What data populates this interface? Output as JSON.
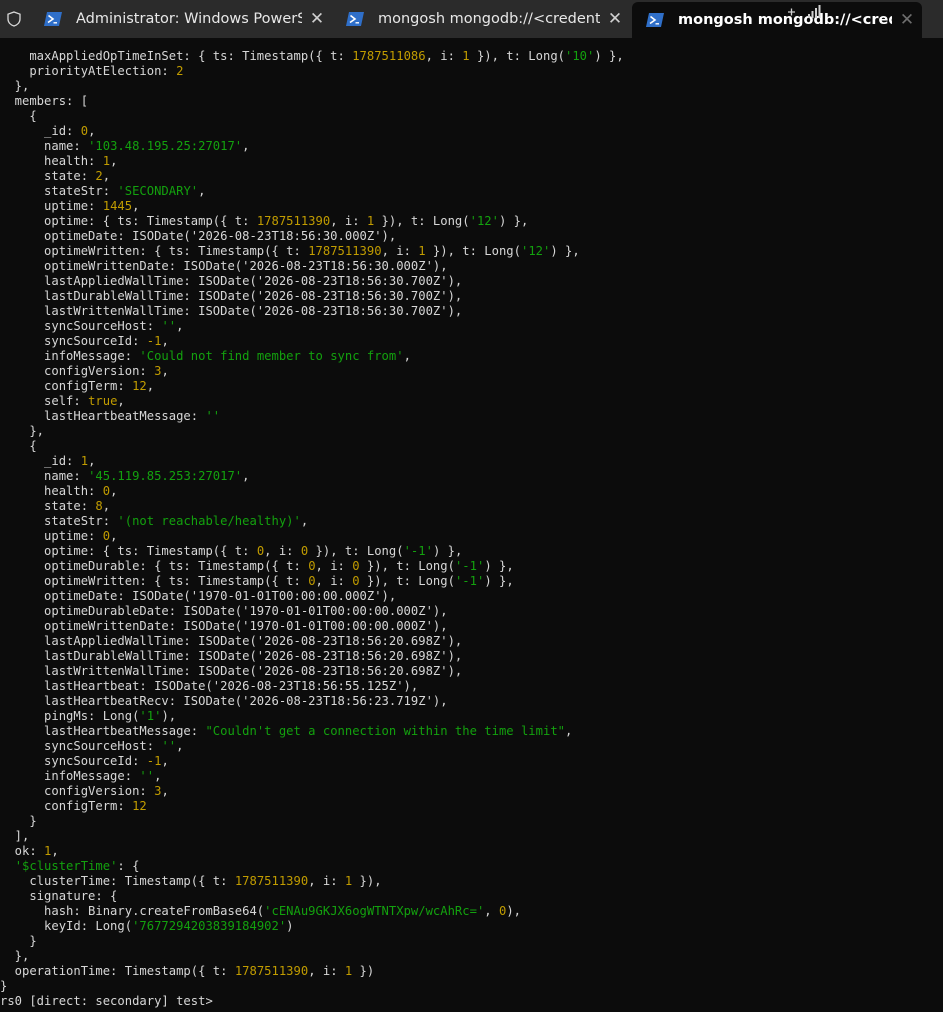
{
  "tabs": [
    {
      "title": "Administrator: Windows PowerShell",
      "close": "✕"
    },
    {
      "title": "mongosh mongodb://<credentials>@",
      "close": "✕"
    },
    {
      "title": "mongosh mongodb://<credentials>@",
      "close": "✕",
      "active": true
    }
  ],
  "icons": {
    "shield": "shield-icon",
    "powershell": "powershell-icon",
    "signal": "signal-icon"
  },
  "colors": {
    "background": "#0c0c0c",
    "text": "#d7d7d7",
    "string": "#13a10e",
    "number": "#c19c00",
    "tabbar": "#2b2b2b"
  },
  "terminal": {
    "lines": [
      [
        [
          "    maxAppliedOpTimeInSet: { ts: Timestamp({ t: ",
          "p"
        ],
        [
          "1787511086",
          "n"
        ],
        [
          ", i: ",
          "p"
        ],
        [
          "1",
          "n"
        ],
        [
          " }), t: Long(",
          "p"
        ],
        [
          "'10'",
          "s"
        ],
        [
          ") },",
          "p"
        ]
      ],
      [
        [
          "    priorityAtElection: ",
          "p"
        ],
        [
          "2",
          "n"
        ]
      ],
      [
        [
          "  },",
          "p"
        ]
      ],
      [
        [
          "  members: [",
          "p"
        ]
      ],
      [
        [
          "    {",
          "p"
        ]
      ],
      [
        [
          "      _id: ",
          "p"
        ],
        [
          "0",
          "n"
        ],
        [
          ",",
          "p"
        ]
      ],
      [
        [
          "      name: ",
          "p"
        ],
        [
          "'103.48.195.25:27017'",
          "s"
        ],
        [
          ",",
          "p"
        ]
      ],
      [
        [
          "      health: ",
          "p"
        ],
        [
          "1",
          "n"
        ],
        [
          ",",
          "p"
        ]
      ],
      [
        [
          "      state: ",
          "p"
        ],
        [
          "2",
          "n"
        ],
        [
          ",",
          "p"
        ]
      ],
      [
        [
          "      stateStr: ",
          "p"
        ],
        [
          "'SECONDARY'",
          "s"
        ],
        [
          ",",
          "p"
        ]
      ],
      [
        [
          "      uptime: ",
          "p"
        ],
        [
          "1445",
          "n"
        ],
        [
          ",",
          "p"
        ]
      ],
      [
        [
          "      optime: { ts: Timestamp({ t: ",
          "p"
        ],
        [
          "1787511390",
          "n"
        ],
        [
          ", i: ",
          "p"
        ],
        [
          "1",
          "n"
        ],
        [
          " }), t: Long(",
          "p"
        ],
        [
          "'12'",
          "s"
        ],
        [
          ") },",
          "p"
        ]
      ],
      [
        [
          "      optimeDate: ISODate('2026-08-23T18:56:30.000Z'),",
          "p"
        ]
      ],
      [
        [
          "      optimeWritten: { ts: Timestamp({ t: ",
          "p"
        ],
        [
          "1787511390",
          "n"
        ],
        [
          ", i: ",
          "p"
        ],
        [
          "1",
          "n"
        ],
        [
          " }), t: Long(",
          "p"
        ],
        [
          "'12'",
          "s"
        ],
        [
          ") },",
          "p"
        ]
      ],
      [
        [
          "      optimeWrittenDate: ISODate('2026-08-23T18:56:30.000Z'),",
          "p"
        ]
      ],
      [
        [
          "      lastAppliedWallTime: ISODate('2026-08-23T18:56:30.700Z'),",
          "p"
        ]
      ],
      [
        [
          "      lastDurableWallTime: ISODate('2026-08-23T18:56:30.700Z'),",
          "p"
        ]
      ],
      [
        [
          "      lastWrittenWallTime: ISODate('2026-08-23T18:56:30.700Z'),",
          "p"
        ]
      ],
      [
        [
          "      syncSourceHost: ",
          "p"
        ],
        [
          "''",
          "s"
        ],
        [
          ",",
          "p"
        ]
      ],
      [
        [
          "      syncSourceId: ",
          "p"
        ],
        [
          "-1",
          "n"
        ],
        [
          ",",
          "p"
        ]
      ],
      [
        [
          "      infoMessage: ",
          "p"
        ],
        [
          "'Could not find member to sync from'",
          "s"
        ],
        [
          ",",
          "p"
        ]
      ],
      [
        [
          "      configVersion: ",
          "p"
        ],
        [
          "3",
          "n"
        ],
        [
          ",",
          "p"
        ]
      ],
      [
        [
          "      configTerm: ",
          "p"
        ],
        [
          "12",
          "n"
        ],
        [
          ",",
          "p"
        ]
      ],
      [
        [
          "      self: ",
          "p"
        ],
        [
          "true",
          "n"
        ],
        [
          ",",
          "p"
        ]
      ],
      [
        [
          "      lastHeartbeatMessage: ",
          "p"
        ],
        [
          "''",
          "s"
        ]
      ],
      [
        [
          "    },",
          "p"
        ]
      ],
      [
        [
          "    {",
          "p"
        ]
      ],
      [
        [
          "      _id: ",
          "p"
        ],
        [
          "1",
          "n"
        ],
        [
          ",",
          "p"
        ]
      ],
      [
        [
          "      name: ",
          "p"
        ],
        [
          "'45.119.85.253:27017'",
          "s"
        ],
        [
          ",",
          "p"
        ]
      ],
      [
        [
          "      health: ",
          "p"
        ],
        [
          "0",
          "n"
        ],
        [
          ",",
          "p"
        ]
      ],
      [
        [
          "      state: ",
          "p"
        ],
        [
          "8",
          "n"
        ],
        [
          ",",
          "p"
        ]
      ],
      [
        [
          "      stateStr: ",
          "p"
        ],
        [
          "'(not reachable/healthy)'",
          "s"
        ],
        [
          ",",
          "p"
        ]
      ],
      [
        [
          "      uptime: ",
          "p"
        ],
        [
          "0",
          "n"
        ],
        [
          ",",
          "p"
        ]
      ],
      [
        [
          "      optime: { ts: Timestamp({ t: ",
          "p"
        ],
        [
          "0",
          "n"
        ],
        [
          ", i: ",
          "p"
        ],
        [
          "0",
          "n"
        ],
        [
          " }), t: Long(",
          "p"
        ],
        [
          "'-1'",
          "s"
        ],
        [
          ") },",
          "p"
        ]
      ],
      [
        [
          "      optimeDurable: { ts: Timestamp({ t: ",
          "p"
        ],
        [
          "0",
          "n"
        ],
        [
          ", i: ",
          "p"
        ],
        [
          "0",
          "n"
        ],
        [
          " }), t: Long(",
          "p"
        ],
        [
          "'-1'",
          "s"
        ],
        [
          ") },",
          "p"
        ]
      ],
      [
        [
          "      optimeWritten: { ts: Timestamp({ t: ",
          "p"
        ],
        [
          "0",
          "n"
        ],
        [
          ", i: ",
          "p"
        ],
        [
          "0",
          "n"
        ],
        [
          " }), t: Long(",
          "p"
        ],
        [
          "'-1'",
          "s"
        ],
        [
          ") },",
          "p"
        ]
      ],
      [
        [
          "      optimeDate: ISODate('1970-01-01T00:00:00.000Z'),",
          "p"
        ]
      ],
      [
        [
          "      optimeDurableDate: ISODate('1970-01-01T00:00:00.000Z'),",
          "p"
        ]
      ],
      [
        [
          "      optimeWrittenDate: ISODate('1970-01-01T00:00:00.000Z'),",
          "p"
        ]
      ],
      [
        [
          "      lastAppliedWallTime: ISODate('2026-08-23T18:56:20.698Z'),",
          "p"
        ]
      ],
      [
        [
          "      lastDurableWallTime: ISODate('2026-08-23T18:56:20.698Z'),",
          "p"
        ]
      ],
      [
        [
          "      lastWrittenWallTime: ISODate('2026-08-23T18:56:20.698Z'),",
          "p"
        ]
      ],
      [
        [
          "      lastHeartbeat: ISODate('2026-08-23T18:56:55.125Z'),",
          "p"
        ]
      ],
      [
        [
          "      lastHeartbeatRecv: ISODate('2026-08-23T18:56:23.719Z'),",
          "p"
        ]
      ],
      [
        [
          "      pingMs: Long(",
          "p"
        ],
        [
          "'1'",
          "s"
        ],
        [
          "),",
          "p"
        ]
      ],
      [
        [
          "      lastHeartbeatMessage: ",
          "p"
        ],
        [
          "\"Couldn't get a connection within the time limit\"",
          "s"
        ],
        [
          ",",
          "p"
        ]
      ],
      [
        [
          "      syncSourceHost: ",
          "p"
        ],
        [
          "''",
          "s"
        ],
        [
          ",",
          "p"
        ]
      ],
      [
        [
          "      syncSourceId: ",
          "p"
        ],
        [
          "-1",
          "n"
        ],
        [
          ",",
          "p"
        ]
      ],
      [
        [
          "      infoMessage: ",
          "p"
        ],
        [
          "''",
          "s"
        ],
        [
          ",",
          "p"
        ]
      ],
      [
        [
          "      configVersion: ",
          "p"
        ],
        [
          "3",
          "n"
        ],
        [
          ",",
          "p"
        ]
      ],
      [
        [
          "      configTerm: ",
          "p"
        ],
        [
          "12",
          "n"
        ]
      ],
      [
        [
          "    }",
          "p"
        ]
      ],
      [
        [
          "  ],",
          "p"
        ]
      ],
      [
        [
          "  ok: ",
          "p"
        ],
        [
          "1",
          "n"
        ],
        [
          ",",
          "p"
        ]
      ],
      [
        [
          "  ",
          "p"
        ],
        [
          "'$clusterTime'",
          "s"
        ],
        [
          ": {",
          "p"
        ]
      ],
      [
        [
          "    clusterTime: Timestamp({ t: ",
          "p"
        ],
        [
          "1787511390",
          "n"
        ],
        [
          ", i: ",
          "p"
        ],
        [
          "1",
          "n"
        ],
        [
          " }),",
          "p"
        ]
      ],
      [
        [
          "    signature: {",
          "p"
        ]
      ],
      [
        [
          "      hash: Binary.createFromBase64(",
          "p"
        ],
        [
          "'cENAu9GKJX6ogWTNTXpw/wcAhRc='",
          "s"
        ],
        [
          ", ",
          "p"
        ],
        [
          "0",
          "n"
        ],
        [
          "),",
          "p"
        ]
      ],
      [
        [
          "      keyId: Long(",
          "p"
        ],
        [
          "'7677294203839184902'",
          "s"
        ],
        [
          ")",
          "p"
        ]
      ],
      [
        [
          "    }",
          "p"
        ]
      ],
      [
        [
          "  },",
          "p"
        ]
      ],
      [
        [
          "  operationTime: Timestamp({ t: ",
          "p"
        ],
        [
          "1787511390",
          "n"
        ],
        [
          ", i: ",
          "p"
        ],
        [
          "1",
          "n"
        ],
        [
          " })",
          "p"
        ]
      ],
      [
        [
          "}",
          "p"
        ]
      ],
      [
        [
          "rs0 [direct: secondary] test> ",
          "p"
        ]
      ]
    ]
  }
}
